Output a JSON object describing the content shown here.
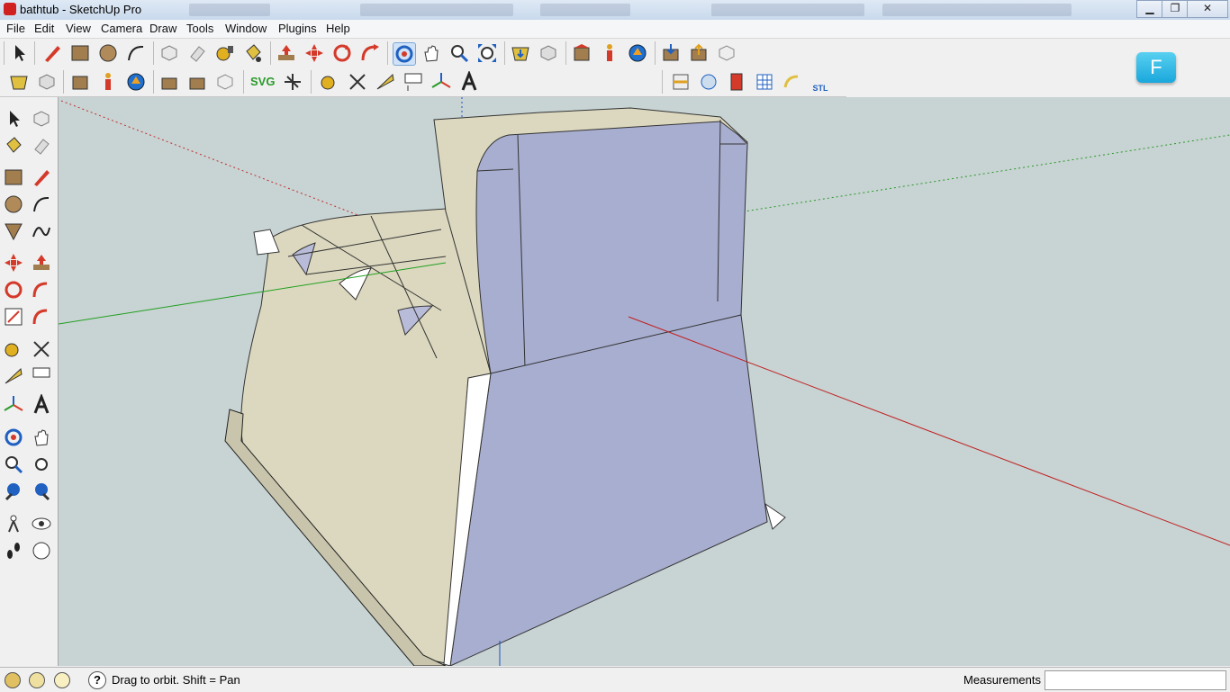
{
  "window": {
    "title": "bathtub - SketchUp Pro",
    "minimize": "▁",
    "restore": "❐",
    "close": "✕"
  },
  "menu": [
    "File",
    "Edit",
    "View",
    "Camera",
    "Draw",
    "Tools",
    "Window",
    "Plugins",
    "Help"
  ],
  "toolbar_row2": {
    "svg_label": "SVG",
    "stl_label": "STL"
  },
  "badge": {
    "letter": "F"
  },
  "status": {
    "hint": "Drag to orbit.  Shift = Pan",
    "help_glyph": "?"
  },
  "measurements": {
    "label": "Measurements",
    "value": ""
  },
  "colors": {
    "viewport_bg": "#c8d3d3",
    "front_face": "#a8aed0",
    "back_face": "#dcd8bf"
  }
}
